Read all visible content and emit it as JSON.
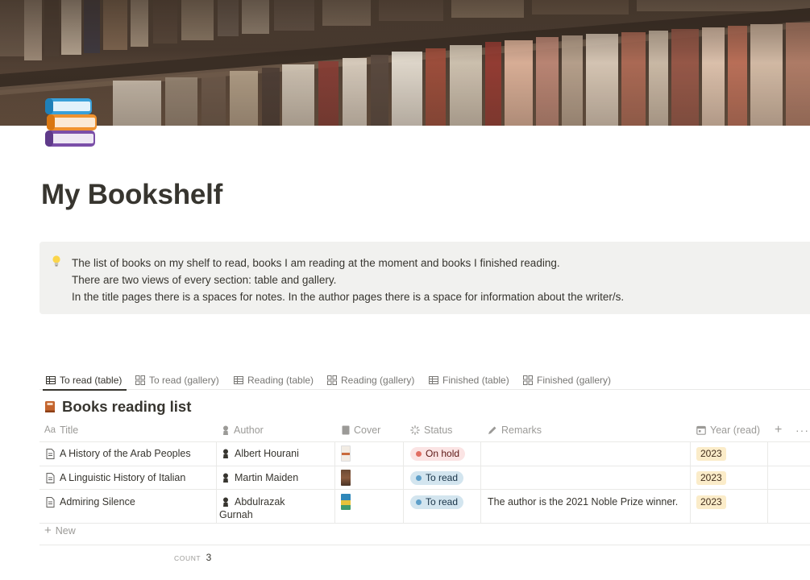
{
  "page": {
    "title": "My Bookshelf",
    "icon": "books-stack-icon"
  },
  "callout": {
    "icon": "lightbulb-icon",
    "lines": [
      "The list of books on my shelf to read, books I am reading at the moment and books I finished reading.",
      "There are two views of every section: table and gallery.",
      "In the title pages there is a spaces for notes. In the author pages there is a space for information about the writer/s."
    ]
  },
  "views": [
    {
      "label": "To read (table)",
      "icon": "table-icon",
      "active": true
    },
    {
      "label": "To read (gallery)",
      "icon": "gallery-icon",
      "active": false
    },
    {
      "label": "Reading (table)",
      "icon": "table-icon",
      "active": false
    },
    {
      "label": "Reading (gallery)",
      "icon": "gallery-icon",
      "active": false
    },
    {
      "label": "Finished (table)",
      "icon": "table-icon",
      "active": false
    },
    {
      "label": "Finished (gallery)",
      "icon": "gallery-icon",
      "active": false
    }
  ],
  "database": {
    "title": "Books reading list",
    "icon": "book-icon",
    "columns": {
      "title": "Title",
      "author": "Author",
      "cover": "Cover",
      "status": "Status",
      "remarks": "Remarks",
      "year": "Year (read)"
    },
    "rows": [
      {
        "title": "A History of the Arab Peoples",
        "author": "Albert Hourani",
        "author_line2": "",
        "status": "On hold",
        "remarks": "",
        "year": "2023"
      },
      {
        "title": "A Linguistic History of Italian",
        "author": "Martin Maiden",
        "author_line2": "",
        "status": "To read",
        "remarks": "",
        "year": "2023"
      },
      {
        "title": "Admiring Silence",
        "author": "Abdulrazak",
        "author_line2": "Gurnah",
        "status": "To read",
        "remarks": "The author is the 2021 Noble Prize winner.",
        "year": "2023"
      }
    ],
    "new_label": "New",
    "count_label": "COUNT",
    "count_value": "3"
  },
  "colors": {
    "on_hold_bg": "#fbe4e4",
    "on_hold_dot": "#e16f64",
    "to_read_bg": "#d3e5ef",
    "to_read_dot": "#5e9fc9",
    "year_bg": "#fbecc9"
  }
}
